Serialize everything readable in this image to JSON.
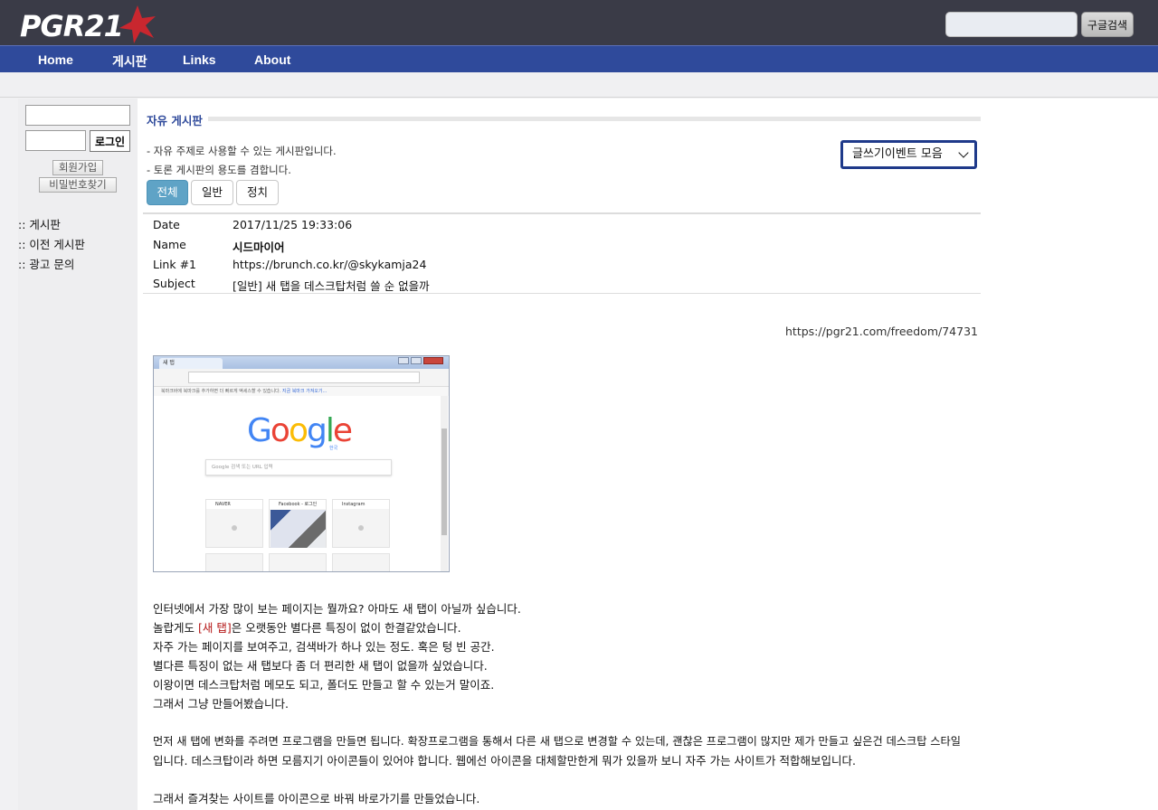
{
  "header": {
    "logo_text": "PGR21",
    "search_placeholder": "",
    "search_button": "구글검색"
  },
  "nav": {
    "items": [
      "Home",
      "게시판",
      "Links",
      "About"
    ]
  },
  "sidebar": {
    "login_button": "로그인",
    "signup_button": "회원가입",
    "find_password_button": "비밀번호찾기",
    "links": [
      ":: 게시판",
      ":: 이전 게시판",
      ":: 광고 문의"
    ]
  },
  "board": {
    "title": "자유 게시판",
    "desc1": "- 자유 주제로 사용할 수 있는 게시판입니다.",
    "desc2": "- 토론 게시판의 용도를 겸합니다.",
    "event_select": "글쓰기이벤트 모음",
    "categories": [
      "전체",
      "일반",
      "정치"
    ],
    "active_category": "전체"
  },
  "post": {
    "labels": {
      "date": "Date",
      "name": "Name",
      "link": "Link #1",
      "subject": "Subject"
    },
    "date": "2017/11/25 19:33:06",
    "name": "시드마이어",
    "link": "https://brunch.co.kr/@skykamja24",
    "subject": "[일반] 새 탭을 데스크탑처럼 쓸 순 없을까",
    "url": "https://pgr21.com/freedom/74731",
    "body": {
      "line1": "인터넷에서 가장 많이 보는 페이지는 뭘까요? 아마도 새 탭이 아닐까 싶습니다.",
      "line2_pre": "놀랍게도 ",
      "line2_red": "[새 탭]",
      "line2_post": "은 오랫동안 별다른 특징이 없이 한결같았습니다.",
      "line3": "자주 가는 페이지를 보여주고, 검색바가 하나 있는 정도. 혹은 텅 빈 공간.",
      "line4": "별다른 특징이 없는 새 탭보다 좀 더 편리한 새 탭이 없을까 싶었습니다.",
      "line5": "이왕이면 데스크탑처럼 메모도 되고, 폴더도 만들고 할 수 있는거 말이죠.",
      "line6": "그래서 그냥 만들어봤습니다.",
      "line7": "먼저 새 탭에 변화를 주려면 프로그램을 만들면 됩니다. 확장프로그램을 통해서 다른 새 탭으로 변경할 수 있는데, 괜찮은 프로그램이 많지만 제가 만들고 싶은건 데스크탑 스타일",
      "line8": "입니다. 데스크탑이라 하면 모름지기 아이콘들이 있어야 합니다. 웹에선 아이콘을 대체할만한게 뭐가 있을까 보니 자주 가는 사이트가 적합해보입니다.",
      "line9": "그래서 즐겨찾는 사이트를 아이콘으로 바꿔 바로가기를 만들었습니다."
    }
  },
  "screenshot": {
    "tab_title": "새 탭",
    "bookmarks_text": "북마크바에 북마크를 추가하면 더 빠르게 액세스할 수 있습니다.",
    "bookmarks_link": "지금 북마크 가져오기...",
    "google_logo": "Google",
    "google_region": "한국",
    "search_placeholder": "Google 검색 또는 URL 입력",
    "tiles": [
      "NAVER",
      "Facebook - 로그인",
      "Instagram"
    ]
  },
  "colors": {
    "header_bg": "#3a3b47",
    "nav_bg": "#2f4a9b",
    "active_category": "#5fa3c6",
    "red_text": "#b51818",
    "logo_star": "#d9262c"
  }
}
